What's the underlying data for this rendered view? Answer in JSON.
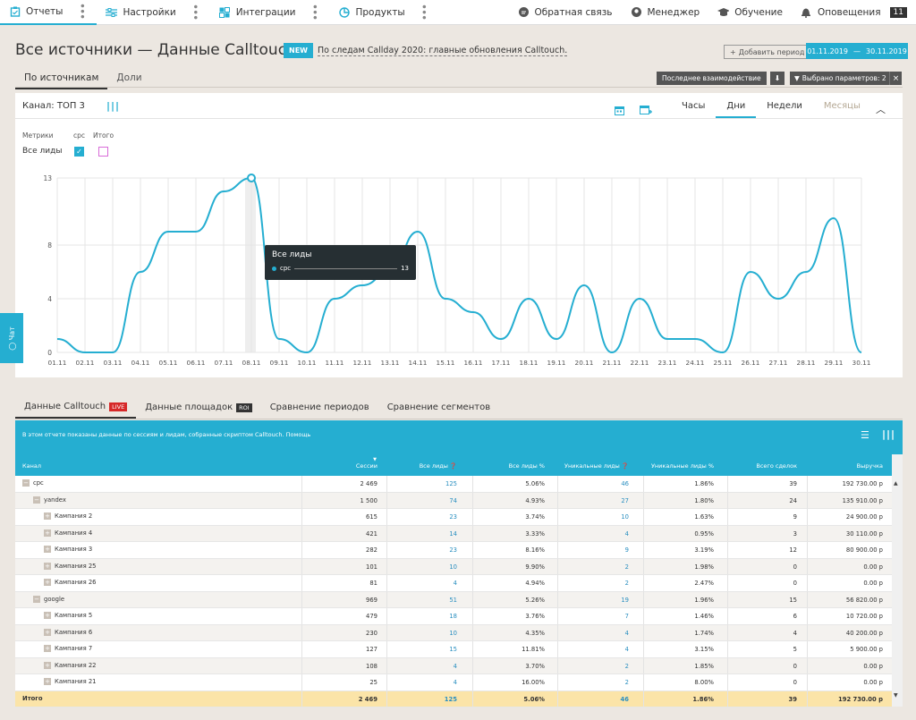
{
  "nav": {
    "left": [
      {
        "label": "Отчеты",
        "icon": "reports-icon"
      },
      {
        "label": "Настройки",
        "icon": "settings-icon"
      },
      {
        "label": "Интеграции",
        "icon": "integrations-icon"
      },
      {
        "label": "Продукты",
        "icon": "products-icon"
      }
    ],
    "right": [
      {
        "label": "Обратная связь",
        "icon": "feedback-icon"
      },
      {
        "label": "Менеджер",
        "icon": "manager-icon"
      },
      {
        "label": "Обучение",
        "icon": "education-icon"
      },
      {
        "label": "Оповещения",
        "icon": "bell-icon",
        "count": "11"
      }
    ]
  },
  "header": {
    "title": "Все источники — Данные Calltouch",
    "new_badge": "NEW",
    "news_link": "По следам Callday 2020: главные обновления Calltouch.",
    "add_period": "Добавить период",
    "date_from": "01.11.2019",
    "date_sep": "—",
    "date_to": "30.11.2019"
  },
  "subtabs": [
    "По источникам",
    "Доли"
  ],
  "toolbar": {
    "last_interaction": "Последнее взаимодействие",
    "filter": "Выбрано параметров: 2"
  },
  "chart_panel": {
    "channel": "Канал: ТОП 3",
    "granularity": [
      "Часы",
      "Дни",
      "Недели",
      "Месяцы"
    ],
    "active_granularity": "Дни",
    "metrics_label": "Метрики",
    "col_cpc": "cpc",
    "col_total": "Итого",
    "metric_row": "Все лиды"
  },
  "chart_data": {
    "type": "line",
    "x": [
      "01.11",
      "02.11",
      "03.11",
      "04.11",
      "05.11",
      "06.11",
      "07.11",
      "08.11",
      "09.11",
      "10.11",
      "11.11",
      "12.11",
      "13.11",
      "14.11",
      "15.11",
      "16.11",
      "17.11",
      "18.11",
      "19.11",
      "20.11",
      "21.11",
      "22.11",
      "23.11",
      "24.11",
      "25.11",
      "26.11",
      "27.11",
      "28.11",
      "29.11",
      "30.11"
    ],
    "series": [
      {
        "name": "cpc",
        "color": "#25aed1",
        "values": [
          1,
          0,
          0,
          6,
          9,
          9,
          12,
          13,
          1,
          0,
          4,
          5,
          6,
          9,
          4,
          3,
          1,
          4,
          1,
          5,
          0,
          4,
          1,
          1,
          0,
          6,
          4,
          6,
          10,
          0
        ]
      }
    ],
    "yticks": [
      0,
      4,
      8,
      13
    ],
    "ylim": [
      0,
      13
    ],
    "grid": true,
    "tooltip": {
      "title": "Все лиды",
      "series": "cpc",
      "value": "13",
      "x": "08.11"
    }
  },
  "chat_tab": "Чат",
  "report_tabs": [
    {
      "label": "Данные Calltouch",
      "tag": "LIVE"
    },
    {
      "label": "Данные площадок",
      "tag": "ROI"
    },
    {
      "label": "Сравнение периодов",
      "tag": ""
    },
    {
      "label": "Сравнение сегментов",
      "tag": ""
    }
  ],
  "table": {
    "info": "В этом отчете показаны данные по сессиям и лидам, собранные скриптом Calltouch. Помощь",
    "headers": [
      "Канал",
      "Сессии",
      "Все лиды",
      "Все лиды %",
      "Уникальные лиды",
      "Уникальные лиды %",
      "Всего сделок",
      "Выручка"
    ],
    "rows": [
      {
        "level": 0,
        "exp": "−",
        "name": "cpc",
        "v": [
          "2 469",
          "125",
          "5.06%",
          "46",
          "1.86%",
          "39",
          "192 730.00 р"
        ]
      },
      {
        "level": 1,
        "exp": "−",
        "name": "yandex",
        "v": [
          "1 500",
          "74",
          "4.93%",
          "27",
          "1.80%",
          "24",
          "135 910.00 р"
        ]
      },
      {
        "level": 2,
        "exp": "+",
        "name": "Кампания 2",
        "v": [
          "615",
          "23",
          "3.74%",
          "10",
          "1.63%",
          "9",
          "24 900.00 р"
        ]
      },
      {
        "level": 2,
        "exp": "+",
        "name": "Кампания 4",
        "v": [
          "421",
          "14",
          "3.33%",
          "4",
          "0.95%",
          "3",
          "30 110.00 р"
        ]
      },
      {
        "level": 2,
        "exp": "+",
        "name": "Кампания 3",
        "v": [
          "282",
          "23",
          "8.16%",
          "9",
          "3.19%",
          "12",
          "80 900.00 р"
        ]
      },
      {
        "level": 2,
        "exp": "+",
        "name": "Кампания 25",
        "v": [
          "101",
          "10",
          "9.90%",
          "2",
          "1.98%",
          "0",
          "0.00 р"
        ]
      },
      {
        "level": 2,
        "exp": "+",
        "name": "Кампания 26",
        "v": [
          "81",
          "4",
          "4.94%",
          "2",
          "2.47%",
          "0",
          "0.00 р"
        ]
      },
      {
        "level": 1,
        "exp": "−",
        "name": "google",
        "v": [
          "969",
          "51",
          "5.26%",
          "19",
          "1.96%",
          "15",
          "56 820.00 р"
        ]
      },
      {
        "level": 2,
        "exp": "+",
        "name": "Кампания 5",
        "v": [
          "479",
          "18",
          "3.76%",
          "7",
          "1.46%",
          "6",
          "10 720.00 р"
        ]
      },
      {
        "level": 2,
        "exp": "+",
        "name": "Кампания 6",
        "v": [
          "230",
          "10",
          "4.35%",
          "4",
          "1.74%",
          "4",
          "40 200.00 р"
        ]
      },
      {
        "level": 2,
        "exp": "+",
        "name": "Кампания 7",
        "v": [
          "127",
          "15",
          "11.81%",
          "4",
          "3.15%",
          "5",
          "5 900.00 р"
        ]
      },
      {
        "level": 2,
        "exp": "+",
        "name": "Кампания 22",
        "v": [
          "108",
          "4",
          "3.70%",
          "2",
          "1.85%",
          "0",
          "0.00 р"
        ]
      },
      {
        "level": 2,
        "exp": "+",
        "name": "Кампания 21",
        "v": [
          "25",
          "4",
          "16.00%",
          "2",
          "8.00%",
          "0",
          "0.00 р"
        ]
      }
    ],
    "total": {
      "name": "Итого",
      "v": [
        "2 469",
        "125",
        "5.06%",
        "46",
        "1.86%",
        "39",
        "192 730.00 р"
      ]
    }
  }
}
